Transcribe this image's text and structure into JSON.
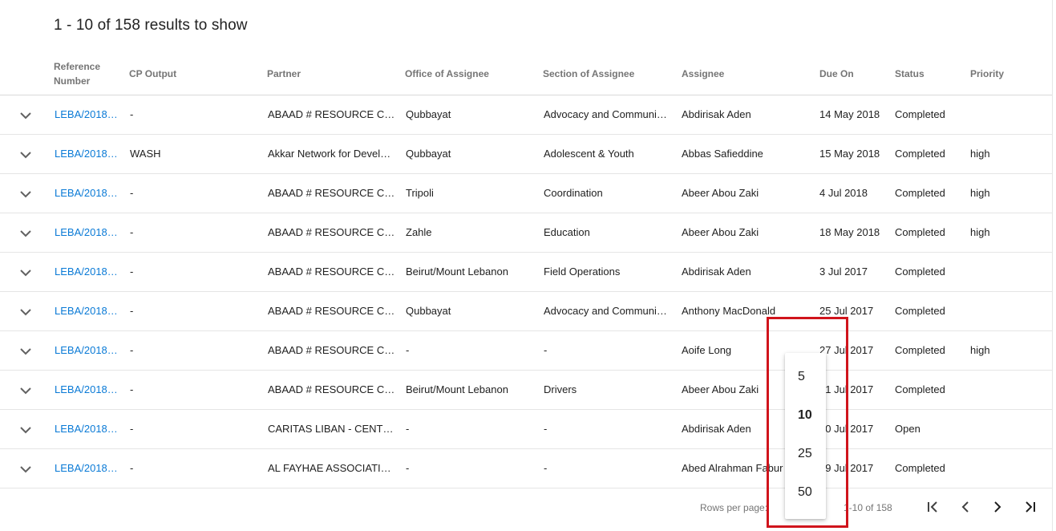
{
  "results_title": "1 - 10 of 158 results to show",
  "columns": {
    "reference_line1": "Reference",
    "reference_line2": "Number",
    "cp_output": "CP Output",
    "partner": "Partner",
    "office": "Office of Assignee",
    "section": "Section of Assignee",
    "assignee": "Assignee",
    "due_on": "Due On",
    "status": "Status",
    "priority": "Priority"
  },
  "rows": [
    {
      "ref": "LEBA/2018…",
      "cp": "-",
      "partner": "ABAAD # RESOURCE CE…",
      "office": "Qubbayat",
      "section": "Advocacy and Communic…",
      "assignee": "Abdirisak Aden",
      "due": "14 May 2018",
      "status": "Completed",
      "priority": ""
    },
    {
      "ref": "LEBA/2018…",
      "cp": "WASH",
      "partner": "Akkar Network for Develo…",
      "office": "Qubbayat",
      "section": "Adolescent & Youth",
      "assignee": "Abbas Safieddine",
      "due": "15 May 2018",
      "status": "Completed",
      "priority": "high"
    },
    {
      "ref": "LEBA/2018…",
      "cp": "-",
      "partner": "ABAAD # RESOURCE CE…",
      "office": "Tripoli",
      "section": "Coordination",
      "assignee": "Abeer Abou Zaki",
      "due": "4 Jul 2018",
      "status": "Completed",
      "priority": "high"
    },
    {
      "ref": "LEBA/2018…",
      "cp": "-",
      "partner": "ABAAD # RESOURCE CE…",
      "office": "Zahle",
      "section": "Education",
      "assignee": "Abeer Abou Zaki",
      "due": "18 May 2018",
      "status": "Completed",
      "priority": "high"
    },
    {
      "ref": "LEBA/2018…",
      "cp": "-",
      "partner": "ABAAD # RESOURCE CE…",
      "office": "Beirut/Mount Lebanon",
      "section": "Field Operations",
      "assignee": "Abdirisak Aden",
      "due": "3 Jul 2017",
      "status": "Completed",
      "priority": ""
    },
    {
      "ref": "LEBA/2018…",
      "cp": "-",
      "partner": "ABAAD # RESOURCE CE…",
      "office": "Qubbayat",
      "section": "Advocacy and Communic…",
      "assignee": "Anthony MacDonald",
      "due": "25 Jul 2017",
      "status": "Completed",
      "priority": ""
    },
    {
      "ref": "LEBA/2018…",
      "cp": "-",
      "partner": "ABAAD # RESOURCE CE…",
      "office": "-",
      "section": "-",
      "assignee": "Aoife Long",
      "due": "27 Jul 2017",
      "status": "Completed",
      "priority": "high"
    },
    {
      "ref": "LEBA/2018…",
      "cp": "-",
      "partner": "ABAAD # RESOURCE CE…",
      "office": "Beirut/Mount Lebanon",
      "section": "Drivers",
      "assignee": "Abeer Abou Zaki",
      "due": "31 Jul 2017",
      "status": "Completed",
      "priority": ""
    },
    {
      "ref": "LEBA/2018…",
      "cp": "-",
      "partner": "CARITAS LIBAN - CENTR…",
      "office": "-",
      "section": "-",
      "assignee": "Abdirisak Aden",
      "due": "10 Jul 2017",
      "status": "Open",
      "priority": ""
    },
    {
      "ref": "LEBA/2018…",
      "cp": "-",
      "partner": "AL FAYHAE ASSOCIATION",
      "office": "-",
      "section": "-",
      "assignee": "Abed Alrahman Fabur",
      "due": "19 Jul 2017",
      "status": "Completed",
      "priority": ""
    }
  ],
  "pagination": {
    "rows_per_page_label": "Rows per page:",
    "range_label": "1-10 of 158",
    "options": [
      "5",
      "10",
      "25",
      "50"
    ],
    "selected": "10"
  },
  "colors": {
    "link": "#0a7ad6",
    "highlight": "#d0141c"
  }
}
